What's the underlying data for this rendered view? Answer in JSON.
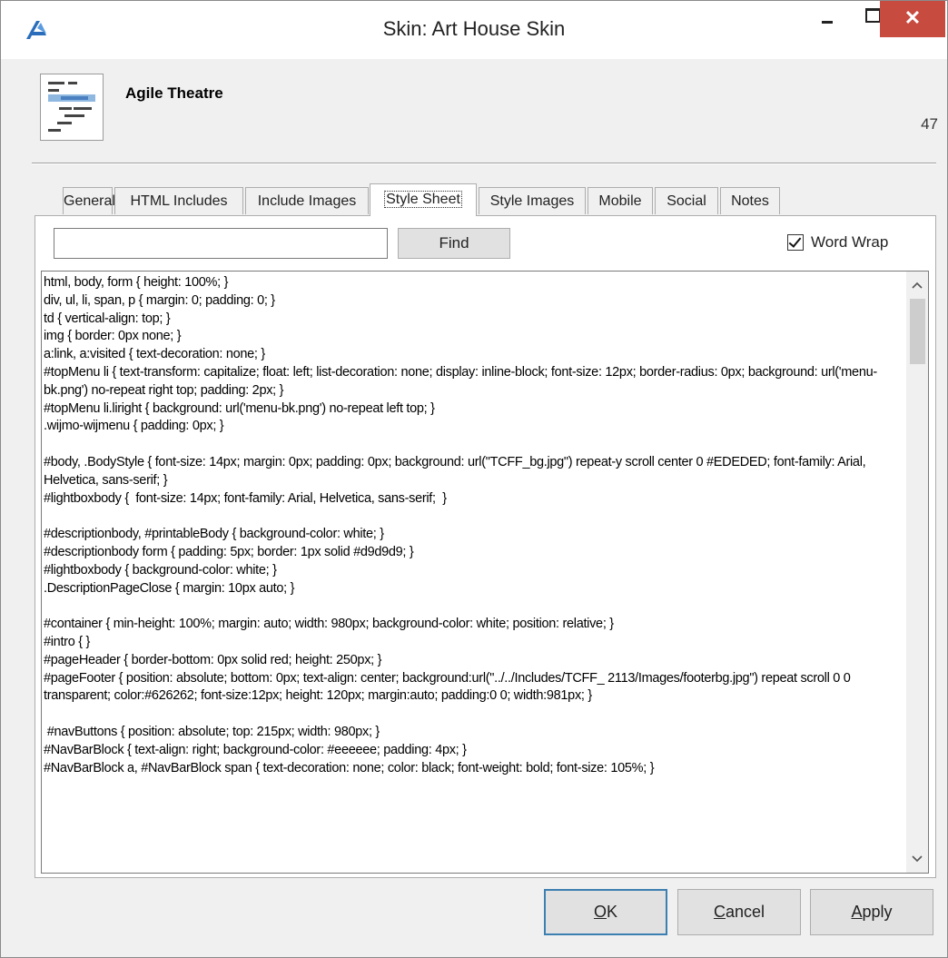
{
  "window": {
    "title": "Skin: Art House Skin",
    "close_symbol": "✕"
  },
  "header": {
    "skin_name": "Agile Theatre",
    "skin_id": "47"
  },
  "tabs": [
    {
      "label": "General"
    },
    {
      "label": "HTML Includes"
    },
    {
      "label": "Include Images"
    },
    {
      "label": "Style Sheet",
      "active": true
    },
    {
      "label": "Style Images"
    },
    {
      "label": "Mobile"
    },
    {
      "label": "Social"
    },
    {
      "label": "Notes"
    }
  ],
  "search": {
    "value": "",
    "find_label": "Find"
  },
  "options": {
    "word_wrap_label": "Word Wrap",
    "word_wrap_checked": true
  },
  "stylesheet": {
    "content": "html, body, form { height: 100%; }\ndiv, ul, li, span, p { margin: 0; padding: 0; }\ntd { vertical-align: top; }\nimg { border: 0px none; }\na:link, a:visited { text-decoration: none; }\n#topMenu li { text-transform: capitalize; float: left; list-decoration: none; display: inline-block; font-size: 12px; border-radius: 0px; background: url('menu-bk.png') no-repeat right top; padding: 2px; }\n#topMenu li.liright { background: url('menu-bk.png') no-repeat left top; }\n.wijmo-wijmenu { padding: 0px; }\n\n#body, .BodyStyle { font-size: 14px; margin: 0px; padding: 0px; background: url(\"TCFF_bg.jpg\") repeat-y scroll center 0 #EDEDED; font-family: Arial, Helvetica, sans-serif; }\n#lightboxbody {  font-size: 14px; font-family: Arial, Helvetica, sans-serif;  }\n\n#descriptionbody, #printableBody { background-color: white; }\n#descriptionbody form { padding: 5px; border: 1px solid #d9d9d9; }\n#lightboxbody { background-color: white; }\n.DescriptionPageClose { margin: 10px auto; }\n\n#container { min-height: 100%; margin: auto; width: 980px; background-color: white; position: relative; }\n#intro { }\n#pageHeader { border-bottom: 0px solid red; height: 250px; }\n#pageFooter { position: absolute; bottom: 0px; text-align: center; background:url(\"../../Includes/TCFF_ 2113/Images/footerbg.jpg\") repeat scroll 0 0 transparent; color:#626262; font-size:12px; height: 120px; margin:auto; padding:0 0; width:981px; }\n\n #navButtons { position: absolute; top: 215px; width: 980px; }\n#NavBarBlock { text-align: right; background-color: #eeeeee; padding: 4px; }\n#NavBarBlock a, #NavBarBlock span { text-decoration: none; color: black; font-weight: bold; font-size: 105%; }"
  },
  "buttons": {
    "ok_key": "O",
    "ok_rest": "K",
    "cancel_key": "C",
    "cancel_rest": "ancel",
    "apply_key": "A",
    "apply_rest": "pply"
  },
  "colors": {
    "close_button": "#c74b3f",
    "logo_blue": "#2a6ebb",
    "default_button_border": "#3c7fb1"
  },
  "icons": {
    "app_logo": "app-logo-icon",
    "minimize": "minimize-icon",
    "maximize": "maximize-icon",
    "close": "close-icon",
    "scroll_up": "chevron-up-icon",
    "scroll_down": "chevron-down-icon"
  }
}
